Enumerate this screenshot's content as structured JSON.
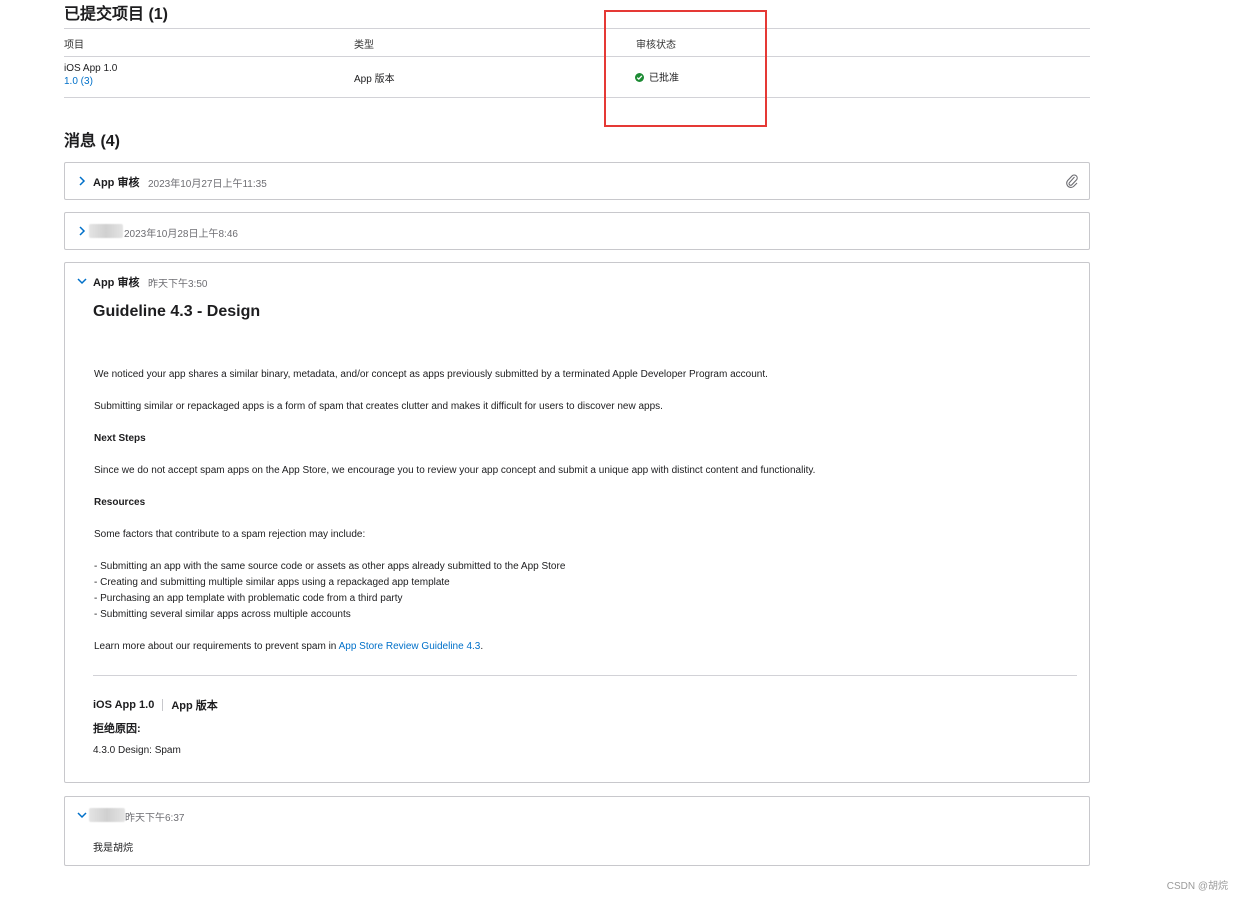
{
  "submitted": {
    "heading": "已提交项目 (1)",
    "columns": [
      "项目",
      "类型",
      "审核状态"
    ],
    "row": {
      "item_name": "iOS App 1.0",
      "item_version": "1.0 (3)",
      "type": "App 版本",
      "status": "已批准"
    }
  },
  "messages": {
    "heading": "消息 (4)",
    "items": [
      {
        "sender": "App 审核",
        "time": "2023年10月27日上午11:35"
      },
      {
        "sender": "",
        "time": "2023年10月28日上午8:46"
      },
      {
        "sender": "App 审核",
        "time": "昨天下午3:50",
        "guideline_title": "Guideline 4.3 - Design",
        "p1": "We noticed your app shares a similar binary, metadata, and/or concept as apps previously submitted by a terminated Apple Developer Program account.",
        "p2": "Submitting similar or repackaged apps is a form of spam that creates clutter and makes it difficult for users to discover new apps.",
        "next_steps_heading": "Next Steps",
        "p3": "Since we do not accept spam apps on the App Store, we encourage you to review your app concept and submit a unique app with distinct content and functionality.",
        "resources_heading": "Resources",
        "p4": "Some factors that contribute to a spam rejection may include:",
        "bullets": [
          "- Submitting an app with the same source code or assets as other apps already submitted to the App Store",
          "- Creating and submitting multiple similar apps using a repackaged app template",
          "- Purchasing an app template with problematic code from a third party",
          "- Submitting several similar apps across multiple accounts"
        ],
        "learn_more_prefix": "Learn more about our requirements to prevent spam in ",
        "learn_more_link": "App Store Review Guideline 4.3",
        "learn_more_suffix": ".",
        "footer_app": "iOS App 1.0",
        "footer_type": "App 版本",
        "reject_label": "拒绝原因:",
        "reject_value": "4.3.0 Design: Spam"
      },
      {
        "sender": "",
        "time": "昨天下午6:37",
        "text": "我是胡烷"
      }
    ]
  },
  "watermark": "CSDN @胡烷",
  "colors": {
    "link": "#0070c9",
    "approved": "#1d8b34",
    "highlight_box": "#e53935"
  }
}
